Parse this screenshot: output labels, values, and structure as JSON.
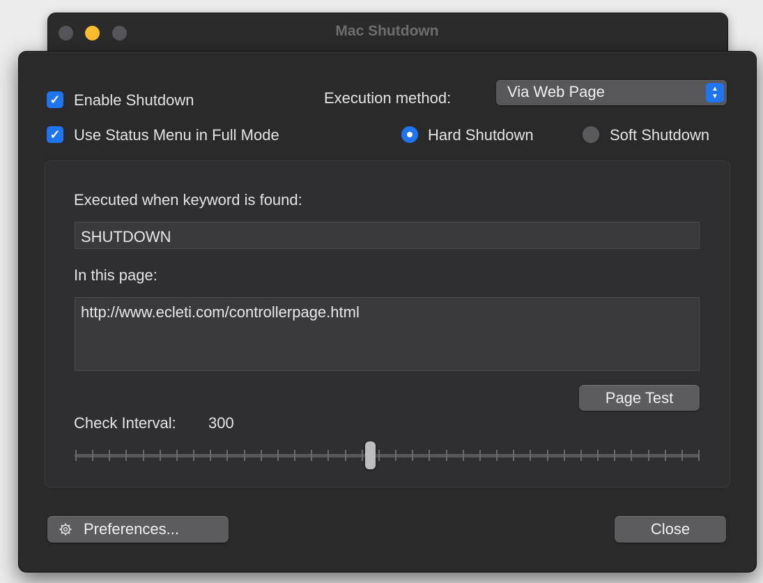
{
  "window": {
    "title": "Mac Shutdown"
  },
  "options": {
    "enable_shutdown_label": "Enable Shutdown",
    "enable_shutdown_checked": true,
    "status_menu_label": "Use Status Menu in Full Mode",
    "status_menu_checked": true
  },
  "execution": {
    "label": "Execution method:",
    "selected": "Via Web Page"
  },
  "shutdown_mode": {
    "hard_label": "Hard Shutdown",
    "soft_label": "Soft Shutdown",
    "selected": "Hard Shutdown"
  },
  "panel": {
    "keyword_label": "Executed when keyword is found:",
    "keyword_value": "SHUTDOWN",
    "page_label": "In this page:",
    "page_value": "http://www.ecleti.com/controllerpage.html",
    "page_test_label": "Page Test",
    "interval_label": "Check Interval:",
    "interval_value": "300"
  },
  "footer": {
    "preferences_label": "Preferences...",
    "close_label": "Close"
  },
  "colors": {
    "accent": "#1f74f0",
    "window_bg": "#2a2a2b",
    "minimize": "#fdbc2e"
  },
  "icons": {
    "preferences": "gear-icon"
  }
}
